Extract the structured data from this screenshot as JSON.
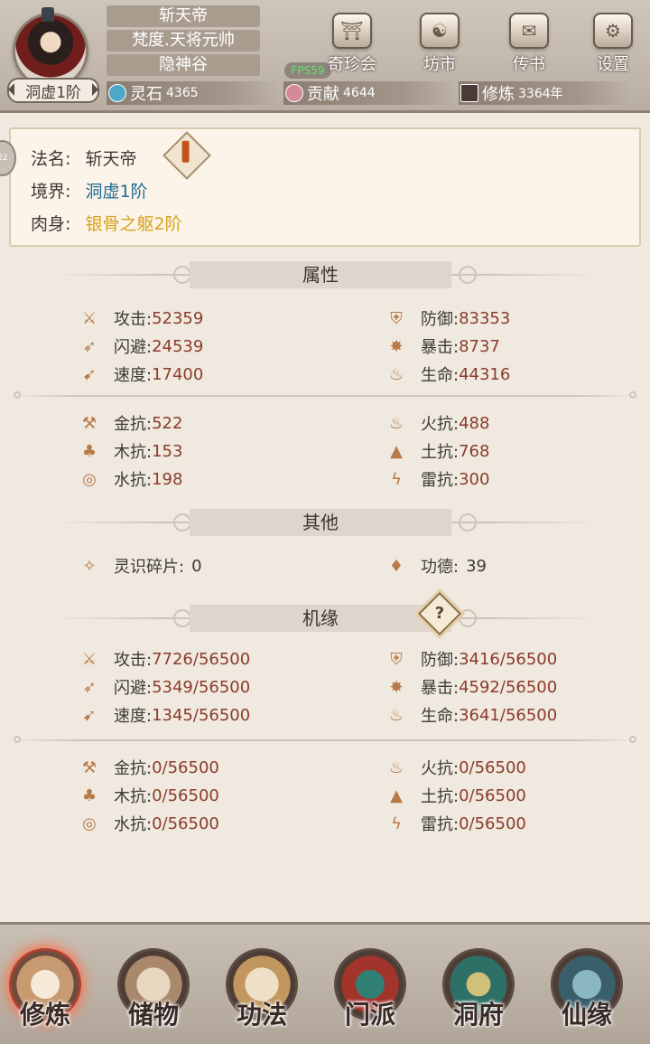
{
  "header": {
    "realm_badge": "洞虚1阶",
    "name_lines": [
      "斩天帝",
      "梵度.天将元帅",
      "隐神谷"
    ],
    "fps": "FPS59",
    "buttons": [
      {
        "label": "奇珍会",
        "icon": "treasure-hall-icon"
      },
      {
        "label": "坊市",
        "icon": "market-icon"
      },
      {
        "label": "传书",
        "icon": "scroll-letter-icon"
      },
      {
        "label": "设置",
        "icon": "gear-icon"
      }
    ],
    "resources": [
      {
        "label": "灵石",
        "value": "4365",
        "icon": "spirit-stone-icon",
        "color": "#4fa7c7"
      },
      {
        "label": "贡献",
        "value": "4644",
        "icon": "contribution-icon",
        "color": "#d58a98"
      },
      {
        "label": "修炼",
        "value": "3364年",
        "icon": "cultivation-hat-icon",
        "color": "#4b3a35"
      }
    ]
  },
  "side_tab": "22",
  "profile": {
    "dharma_name_label": "法名:",
    "dharma_name_value": "斩天帝",
    "realm_label": "境界:",
    "realm_value": "洞虚1阶",
    "body_label": "肉身:",
    "body_value": "银骨之躯2阶"
  },
  "sections": {
    "attributes_title": "属性",
    "other_title": "其他",
    "fortune_title": "机缘"
  },
  "attributes": [
    {
      "label": "攻击:",
      "value": "52359",
      "icon": "sword-attack-icon"
    },
    {
      "label": "防御:",
      "value": "83353",
      "icon": "shield-defense-icon"
    },
    {
      "label": "闪避:",
      "value": "24539",
      "icon": "dodge-icon"
    },
    {
      "label": "暴击:",
      "value": "8737",
      "icon": "critical-icon"
    },
    {
      "label": "速度:",
      "value": "17400",
      "icon": "speed-icon"
    },
    {
      "label": "生命:",
      "value": "44316",
      "icon": "life-icon"
    },
    {
      "label": "金抗:",
      "value": "522",
      "icon": "metal-resist-icon"
    },
    {
      "label": "火抗:",
      "value": "488",
      "icon": "fire-resist-icon"
    },
    {
      "label": "木抗:",
      "value": "153",
      "icon": "wood-resist-icon"
    },
    {
      "label": "土抗:",
      "value": "768",
      "icon": "earth-resist-icon"
    },
    {
      "label": "水抗:",
      "value": "198",
      "icon": "water-resist-icon"
    },
    {
      "label": "雷抗:",
      "value": "300",
      "icon": "thunder-resist-icon"
    }
  ],
  "other": [
    {
      "label": "灵识碎片:",
      "value": "0",
      "icon": "spirit-fragment-icon"
    },
    {
      "label": "功德:",
      "value": "39",
      "icon": "merit-icon"
    }
  ],
  "fortune": [
    {
      "label": "攻击:",
      "value": "7726/56500",
      "icon": "sword-attack-icon"
    },
    {
      "label": "防御:",
      "value": "3416/56500",
      "icon": "shield-defense-icon"
    },
    {
      "label": "闪避:",
      "value": "5349/56500",
      "icon": "dodge-icon"
    },
    {
      "label": "暴击:",
      "value": "4592/56500",
      "icon": "critical-icon"
    },
    {
      "label": "速度:",
      "value": "1345/56500",
      "icon": "speed-icon"
    },
    {
      "label": "生命:",
      "value": "3641/56500",
      "icon": "life-icon"
    },
    {
      "label": "金抗:",
      "value": "0/56500",
      "icon": "metal-resist-icon"
    },
    {
      "label": "火抗:",
      "value": "0/56500",
      "icon": "fire-resist-icon"
    },
    {
      "label": "木抗:",
      "value": "0/56500",
      "icon": "wood-resist-icon"
    },
    {
      "label": "土抗:",
      "value": "0/56500",
      "icon": "earth-resist-icon"
    },
    {
      "label": "水抗:",
      "value": "0/56500",
      "icon": "water-resist-icon"
    },
    {
      "label": "雷抗:",
      "value": "0/56500",
      "icon": "thunder-resist-icon"
    }
  ],
  "fortune_help": "?",
  "nav": [
    {
      "label": "修炼",
      "icon": "cultivate-icon",
      "active": true
    },
    {
      "label": "储物",
      "icon": "storage-bag-icon",
      "active": false
    },
    {
      "label": "功法",
      "icon": "technique-scroll-icon",
      "active": false
    },
    {
      "label": "门派",
      "icon": "sect-gate-icon",
      "active": false
    },
    {
      "label": "洞府",
      "icon": "cave-dwelling-icon",
      "active": false
    },
    {
      "label": "仙缘",
      "icon": "immortal-fate-icon",
      "active": false
    }
  ],
  "colors": {
    "stat_value": "#8c3b2b",
    "realm_value": "#1e6c95",
    "body_value": "#d7a21b",
    "active_nav_glow": "#f47d5c"
  }
}
